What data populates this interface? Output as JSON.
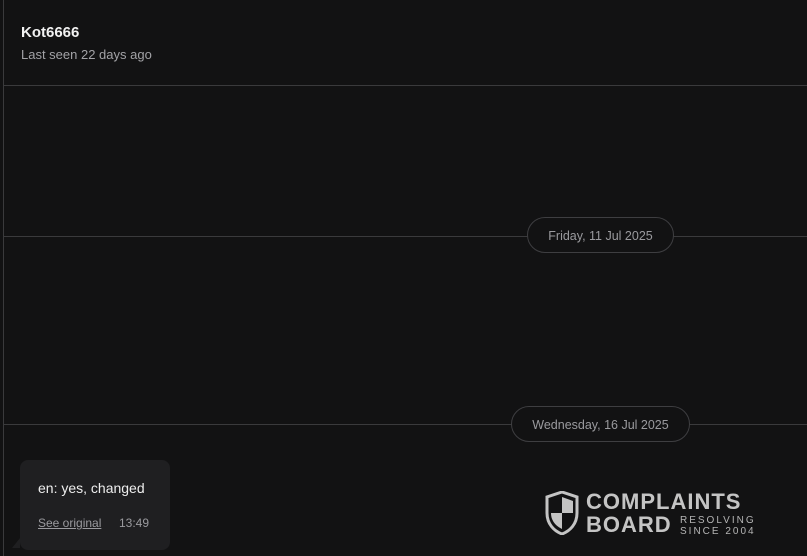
{
  "header": {
    "contact_name": "Kot6666",
    "last_seen": "Last seen 22 days ago"
  },
  "date_separators": [
    "Friday, 11 Jul 2025",
    "Wednesday, 16 Jul 2025"
  ],
  "message": {
    "text": "en: yes, changed",
    "see_original_label": "See original",
    "time": "13:49"
  },
  "watermark": {
    "line1": "COMPLAINTS",
    "line2": "BOARD",
    "tagline1": "RESOLVING",
    "tagline2": "SINCE 2004"
  },
  "colors": {
    "background": "#121213",
    "bubble": "#1f1f21",
    "divider": "#3a3a3c",
    "text_primary": "#f2f2f2",
    "text_secondary": "#9a9a9e"
  }
}
